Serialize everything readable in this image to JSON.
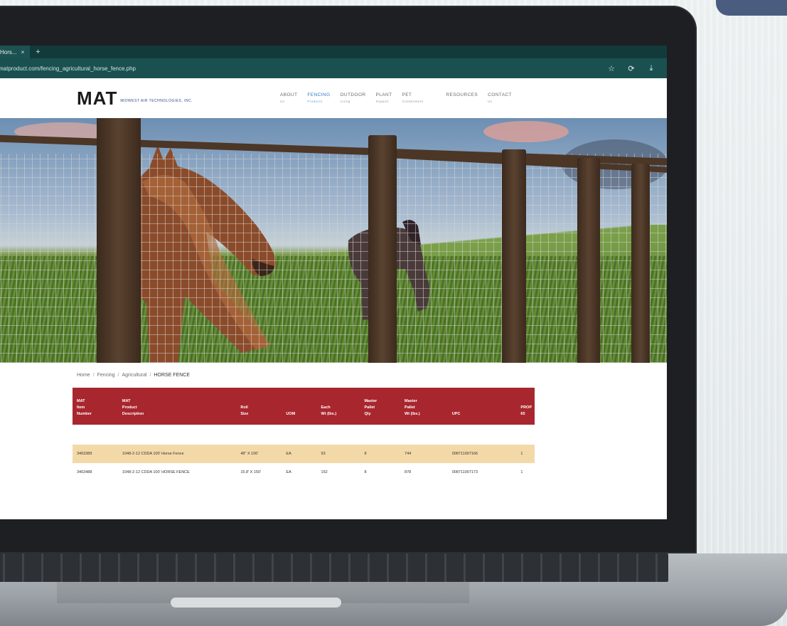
{
  "browser": {
    "tab_title": "Hors...",
    "tab_close": "×",
    "new_tab": "+",
    "url": "matproduct.com/fencing_agricultural_horse_fence.php",
    "star_icon": "☆",
    "refresh_icon": "⟳",
    "download_icon": "⤓"
  },
  "site": {
    "logo_mark": "MAT",
    "logo_tag": "MIDWEST AIR TECHNOLOGIES, INC.",
    "nav": [
      {
        "label": "ABOUT",
        "sub": "Us"
      },
      {
        "label": "FENCING",
        "sub": "Products"
      },
      {
        "label": "OUTDOOR",
        "sub": "Living"
      },
      {
        "label": "PLANT",
        "sub": "Support"
      },
      {
        "label": "PET",
        "sub": "Containment"
      },
      {
        "label": "RESOURCES",
        "sub": ""
      },
      {
        "label": "CONTACT",
        "sub": "Us"
      }
    ]
  },
  "breadcrumb": {
    "home": "Home",
    "fencing": "Fencing",
    "agricultural": "Agricultural",
    "current": "HORSE FENCE"
  },
  "table": {
    "headers": [
      [
        "MAT",
        "Item",
        "Number"
      ],
      [
        "MAT",
        "Product",
        "Description"
      ],
      [
        "Roll",
        "Size"
      ],
      [
        "UOM"
      ],
      [
        "Each",
        "Wt (lbs.)"
      ],
      [
        "Master",
        "Pallet",
        "Qty"
      ],
      [
        "Master",
        "Pallet",
        "Wt (lbs.)"
      ],
      [
        "UPC"
      ],
      [
        "PROP",
        "65"
      ]
    ],
    "rows": [
      [
        "3463389",
        "1048-2-12 CDDA 100' Horse Fence",
        "48\" X 100'",
        "EA",
        "93",
        "8",
        "744",
        "008711007166",
        "1"
      ],
      [
        "3463488",
        "1048-2-12 CDDA 100' HORSE FENCE",
        "15.8' X 150'",
        "EA",
        "152",
        "8",
        "878",
        "008711007173",
        "1"
      ]
    ]
  },
  "colors": {
    "header_red": "#a8262e",
    "row_highlight": "#f4d9a8",
    "nav_active": "#2e78c7",
    "browser_chrome": "#1a5050"
  }
}
